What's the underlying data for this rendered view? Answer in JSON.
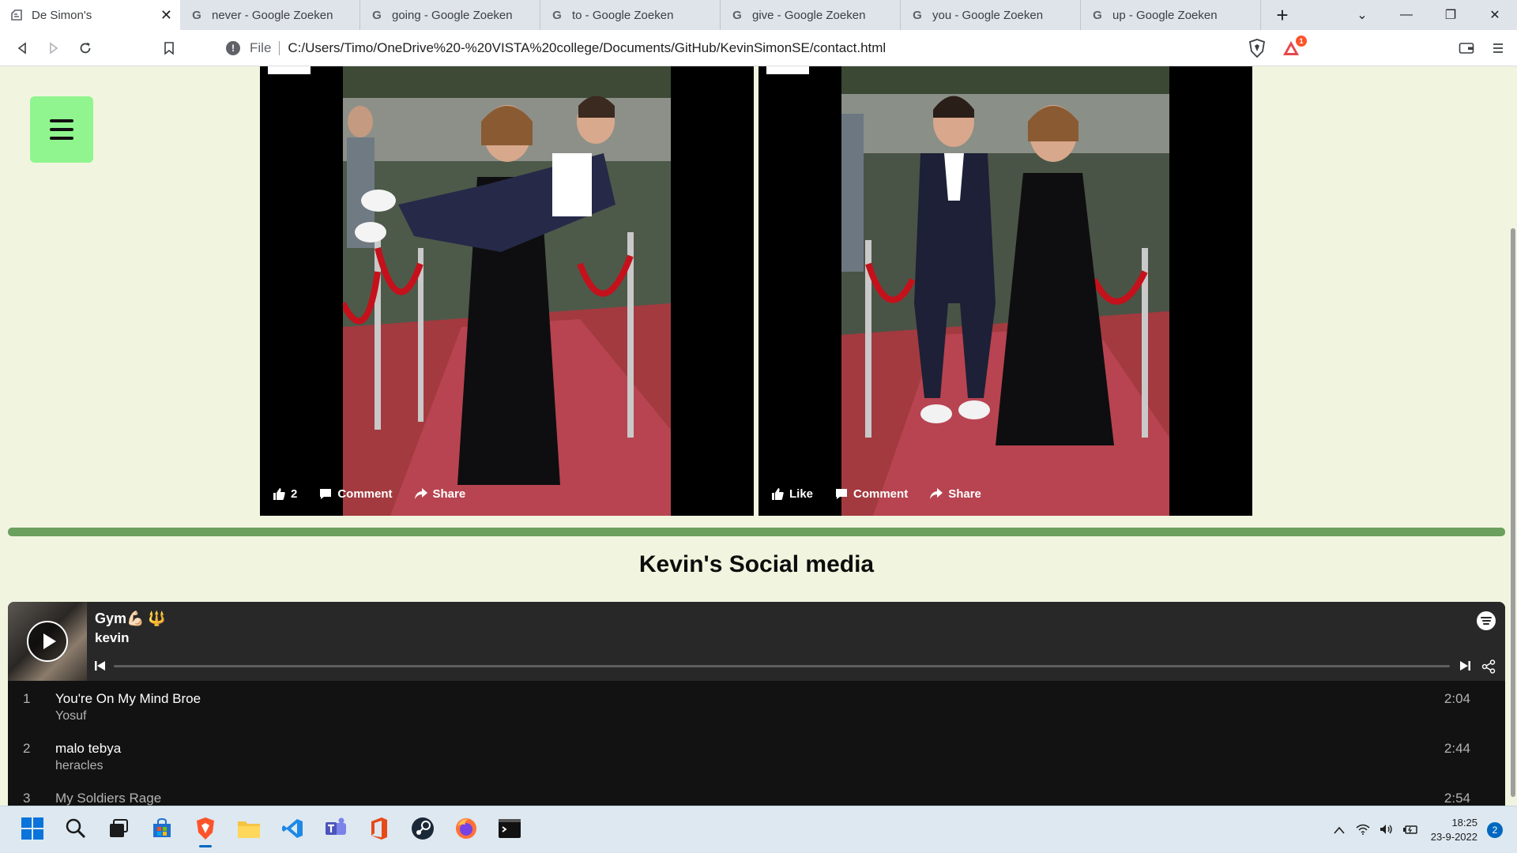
{
  "browser": {
    "tabs": [
      {
        "title": "De Simon's",
        "icon": "page-icon",
        "active": true
      },
      {
        "title": "never - Google Zoeken",
        "icon": "google-icon"
      },
      {
        "title": "going - Google Zoeken",
        "icon": "google-icon"
      },
      {
        "title": "to - Google Zoeken",
        "icon": "google-icon"
      },
      {
        "title": "give - Google Zoeken",
        "icon": "google-icon"
      },
      {
        "title": "you - Google Zoeken",
        "icon": "google-icon"
      },
      {
        "title": "up - Google Zoeken",
        "icon": "google-icon"
      }
    ],
    "address": {
      "scheme": "File",
      "url": "C:/Users/Timo/OneDrive%20-%20VISTA%20college/Documents/GitHub/KevinSimonSE/contact.html"
    },
    "rewards_badge": "1"
  },
  "page": {
    "posts": [
      {
        "like_label": "2",
        "comment_label": "Comment",
        "share_label": "Share"
      },
      {
        "like_label": "Like",
        "comment_label": "Comment",
        "share_label": "Share"
      }
    ],
    "section_title": "Kevin's Social media",
    "divider_color": "#6ba05e",
    "menu_color": "#90f58e"
  },
  "spotify": {
    "playlist_name": "Gym💪🏻 🔱",
    "owner": "kevin",
    "tracks": [
      {
        "num": "1",
        "name": "You're On My Mind Broe",
        "artist": "Yosuf",
        "duration": "2:04"
      },
      {
        "num": "2",
        "name": "malo tebya",
        "artist": "heracles",
        "duration": "2:44"
      },
      {
        "num": "3",
        "name": "My Soldiers Rage",
        "artist": "",
        "duration": "2:54"
      }
    ]
  },
  "taskbar": {
    "apps": [
      "windows-start-icon",
      "search-icon",
      "task-view-icon",
      "store-icon",
      "brave-icon",
      "file-explorer-icon",
      "vscode-icon",
      "teams-icon",
      "office-icon",
      "steam-icon",
      "firefox-icon",
      "terminal-icon"
    ],
    "time": "18:25",
    "date": "23-9-2022",
    "notifications": "2"
  }
}
